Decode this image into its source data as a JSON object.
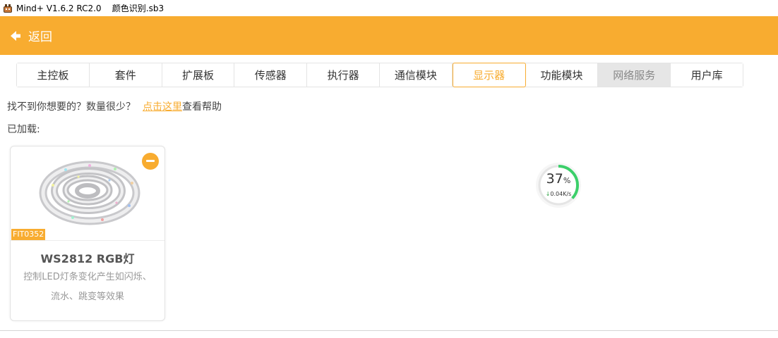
{
  "window": {
    "title": "Mind+ V1.6.2 RC2.0    颜色识别.sb3"
  },
  "header": {
    "back_label": "返回",
    "accent_color": "#f8ac30"
  },
  "tabs": [
    {
      "label": "主控板",
      "state": "normal"
    },
    {
      "label": "套件",
      "state": "normal"
    },
    {
      "label": "扩展板",
      "state": "normal"
    },
    {
      "label": "传感器",
      "state": "normal"
    },
    {
      "label": "执行器",
      "state": "normal"
    },
    {
      "label": "通信模块",
      "state": "normal"
    },
    {
      "label": "显示器",
      "state": "active"
    },
    {
      "label": "功能模块",
      "state": "normal"
    },
    {
      "label": "网络服务",
      "state": "disabled"
    },
    {
      "label": "用户库",
      "state": "normal"
    }
  ],
  "help": {
    "prefix": "找不到你想要的？数量很少？",
    "link": "点击这里",
    "suffix": "查看帮助"
  },
  "loaded_label": "已加载:",
  "card": {
    "sku": "FIT0352",
    "title": "WS2812 RGB灯",
    "desc_line1": "控制LED灯条变化产生如闪烁、",
    "desc_line2": "流水、跳变等效果",
    "image_icon": "led-strip-image",
    "remove_icon": "remove-icon"
  },
  "progress": {
    "percent": "37",
    "percent_unit": "%",
    "percent_value": 0.37,
    "speed": "0.04K/s",
    "arrow_icon": "download-arrow-icon",
    "ring_color": "#3ccf6a"
  }
}
